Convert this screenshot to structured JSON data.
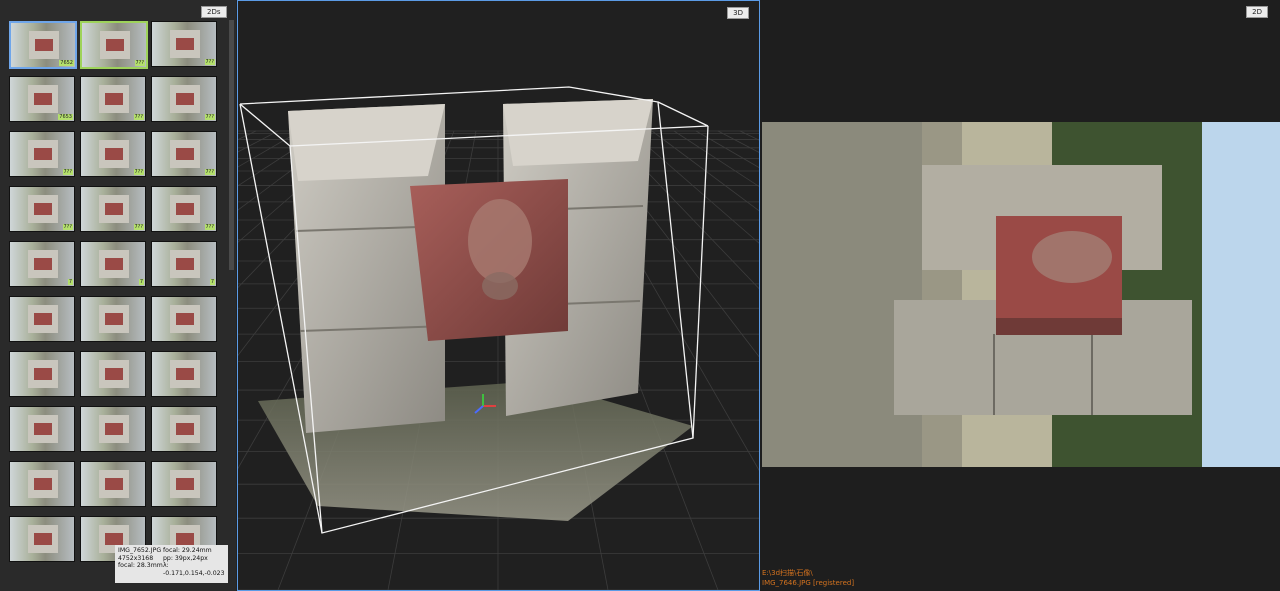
{
  "views": {
    "thumbnails_tag": "2Ds",
    "viewport_tag": "3D",
    "image_tag": "2D"
  },
  "thumbnails": [
    {
      "badge": "7652",
      "state": "selected"
    },
    {
      "badge": "7??",
      "state": "highlighted"
    },
    {
      "badge": "7??",
      "state": "normal"
    },
    {
      "badge": "7653",
      "state": "normal"
    },
    {
      "badge": "7??",
      "state": "normal"
    },
    {
      "badge": "7??",
      "state": "normal"
    },
    {
      "badge": "7??",
      "state": "normal"
    },
    {
      "badge": "7??",
      "state": "normal"
    },
    {
      "badge": "7??",
      "state": "normal"
    },
    {
      "badge": "7??",
      "state": "normal"
    },
    {
      "badge": "7??",
      "state": "normal"
    },
    {
      "badge": "7??",
      "state": "normal"
    },
    {
      "badge": "7",
      "state": "normal"
    },
    {
      "badge": "7",
      "state": "normal"
    },
    {
      "badge": "7",
      "state": "normal"
    },
    {
      "badge": "",
      "state": "normal"
    },
    {
      "badge": "",
      "state": "normal"
    },
    {
      "badge": "",
      "state": "normal"
    },
    {
      "badge": "",
      "state": "normal"
    },
    {
      "badge": "",
      "state": "normal"
    },
    {
      "badge": "",
      "state": "normal"
    },
    {
      "badge": "",
      "state": "normal"
    },
    {
      "badge": "",
      "state": "normal"
    },
    {
      "badge": "",
      "state": "normal"
    },
    {
      "badge": "",
      "state": "normal"
    },
    {
      "badge": "",
      "state": "normal"
    },
    {
      "badge": "",
      "state": "normal"
    },
    {
      "badge": "",
      "state": "normal"
    },
    {
      "badge": "",
      "state": "normal"
    },
    {
      "badge": "",
      "state": "normal"
    }
  ],
  "tooltip": {
    "filename": "IMG_7652.JPG",
    "resolution": "4752x3168",
    "focal_mm": "focal: 28.3mm",
    "focal_calib": "focal: 29.24mm",
    "pp": "pp: 39px,24px",
    "lambda": "λ: -0.171,0.154,-0.023"
  },
  "status": {
    "path": "E:\\3d扫描\\石像\\",
    "image_info": "IMG_7646.JPG [registered]"
  },
  "colors": {
    "selected_border": "#6fa6ea",
    "highlight_border": "#9ed35a",
    "viewport_border": "#5b9be6",
    "status_text": "#d4731f",
    "plaque": "#9a4a46"
  }
}
